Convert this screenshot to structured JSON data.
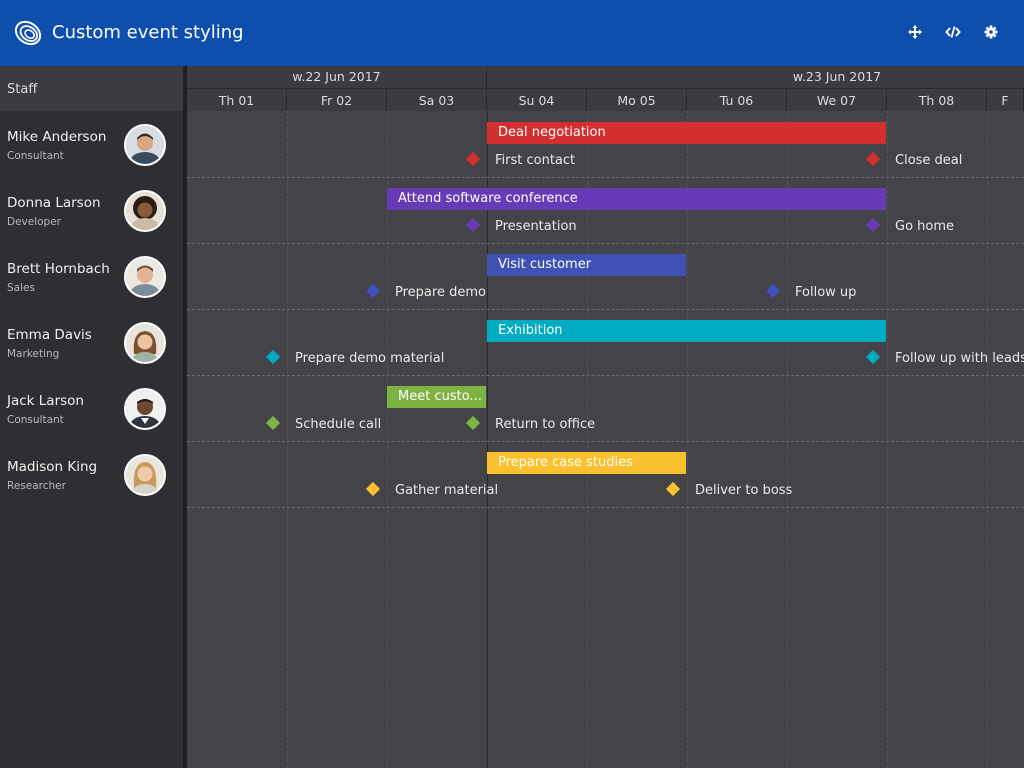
{
  "header": {
    "title": "Custom event styling",
    "tools": [
      "move-icon",
      "code-icon",
      "gear-icon"
    ],
    "color": "#0e4fad"
  },
  "staff_header": "Staff",
  "staff": [
    {
      "name": "Mike Anderson",
      "role": "Consultant"
    },
    {
      "name": "Donna Larson",
      "role": "Developer"
    },
    {
      "name": "Brett Hornbach",
      "role": "Sales"
    },
    {
      "name": "Emma Davis",
      "role": "Marketing"
    },
    {
      "name": "Jack Larson",
      "role": "Consultant"
    },
    {
      "name": "Madison King",
      "role": "Researcher"
    }
  ],
  "weeks": [
    "w.22 Jun 2017",
    "w.23 Jun 2017"
  ],
  "days": [
    "Th 01",
    "Fr 02",
    "Sa 03",
    "Su 04",
    "Mo 05",
    "Tu 06",
    "We 07",
    "Th 08",
    "F"
  ],
  "events": [
    {
      "name": "Deal negotiation",
      "color": "#d32f2f"
    },
    {
      "name": "Attend software conference",
      "color": "#673ab7"
    },
    {
      "name": "Visit customer",
      "color": "#3f51b5"
    },
    {
      "name": "Exhibition",
      "color": "#00acc1"
    },
    {
      "name": "Meet custo...",
      "color": "#7cb342"
    },
    {
      "name": "Prepare case studies",
      "color": "#fbc02d"
    }
  ],
  "milestones": [
    {
      "name": "First contact",
      "color": "#d32f2f"
    },
    {
      "name": "Close deal",
      "color": "#d32f2f"
    },
    {
      "name": "Presentation",
      "color": "#673ab7"
    },
    {
      "name": "Go home",
      "color": "#673ab7"
    },
    {
      "name": "Prepare demo",
      "color": "#3f51b5"
    },
    {
      "name": "Follow up",
      "color": "#3f51b5"
    },
    {
      "name": "Prepare demo material",
      "color": "#00acc1"
    },
    {
      "name": "Follow up with leads",
      "color": "#00acc1"
    },
    {
      "name": "Schedule call",
      "color": "#7cb342"
    },
    {
      "name": "Return to office",
      "color": "#7cb342"
    },
    {
      "name": "Gather material",
      "color": "#fbc02d"
    },
    {
      "name": "Deliver to boss",
      "color": "#fbc02d"
    }
  ]
}
